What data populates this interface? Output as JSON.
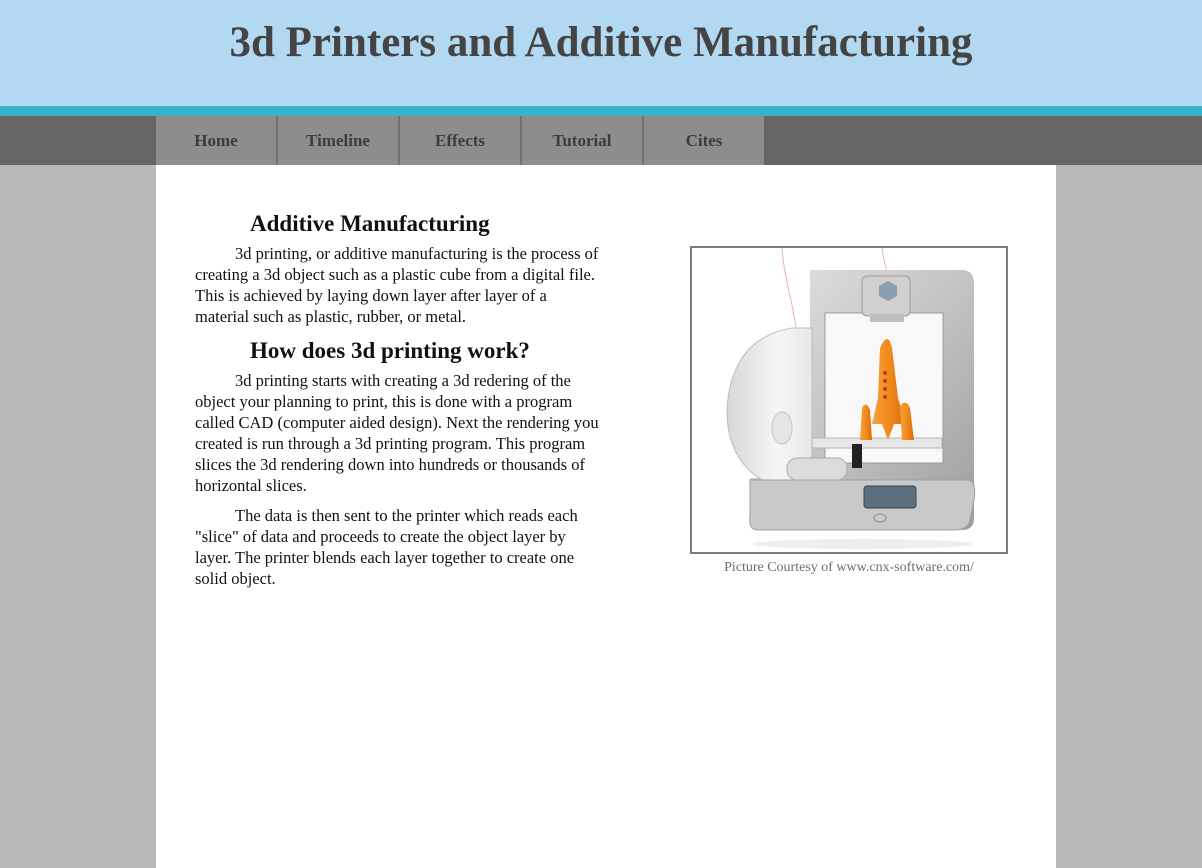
{
  "header": {
    "title": "3d Printers and Additive Manufacturing"
  },
  "nav": {
    "items": [
      {
        "label": "Home"
      },
      {
        "label": "Timeline"
      },
      {
        "label": "Effects"
      },
      {
        "label": "Tutorial"
      },
      {
        "label": "Cites"
      }
    ]
  },
  "article": {
    "heading1": "Additive Manufacturing",
    "para1": "3d printing, or additive manufacturing is the process of creating a 3d object such as a plastic cube from a digital file. This is achieved by laying down layer after layer of a material such as plastic, rubber, or metal.",
    "heading2": "How does 3d printing work?",
    "para2": "3d printing starts with creating a 3d redering of the object your planning to print, this is done with a program called CAD (computer aided design). Next the rendering you created is run through a 3d printing program. This program slices the 3d rendering down into hundreds or thousands of horizontal slices.",
    "para3": "The data is then sent to the printer which reads each \"slice\" of data and proceeds to create the object layer by layer. The printer blends each layer together to create one solid object."
  },
  "figure": {
    "image_icon": "3d-printer-image",
    "caption": "Picture Courtesy of www.cnx-software.com/"
  },
  "colors": {
    "header_bg": "#b3d8f2",
    "stripe": "#38b3cd",
    "nav_bg": "#666666",
    "nav_item_bg": "#8d8d8d",
    "page_bg": "#b9b9b9",
    "accent_orange": "#f28a1c"
  }
}
